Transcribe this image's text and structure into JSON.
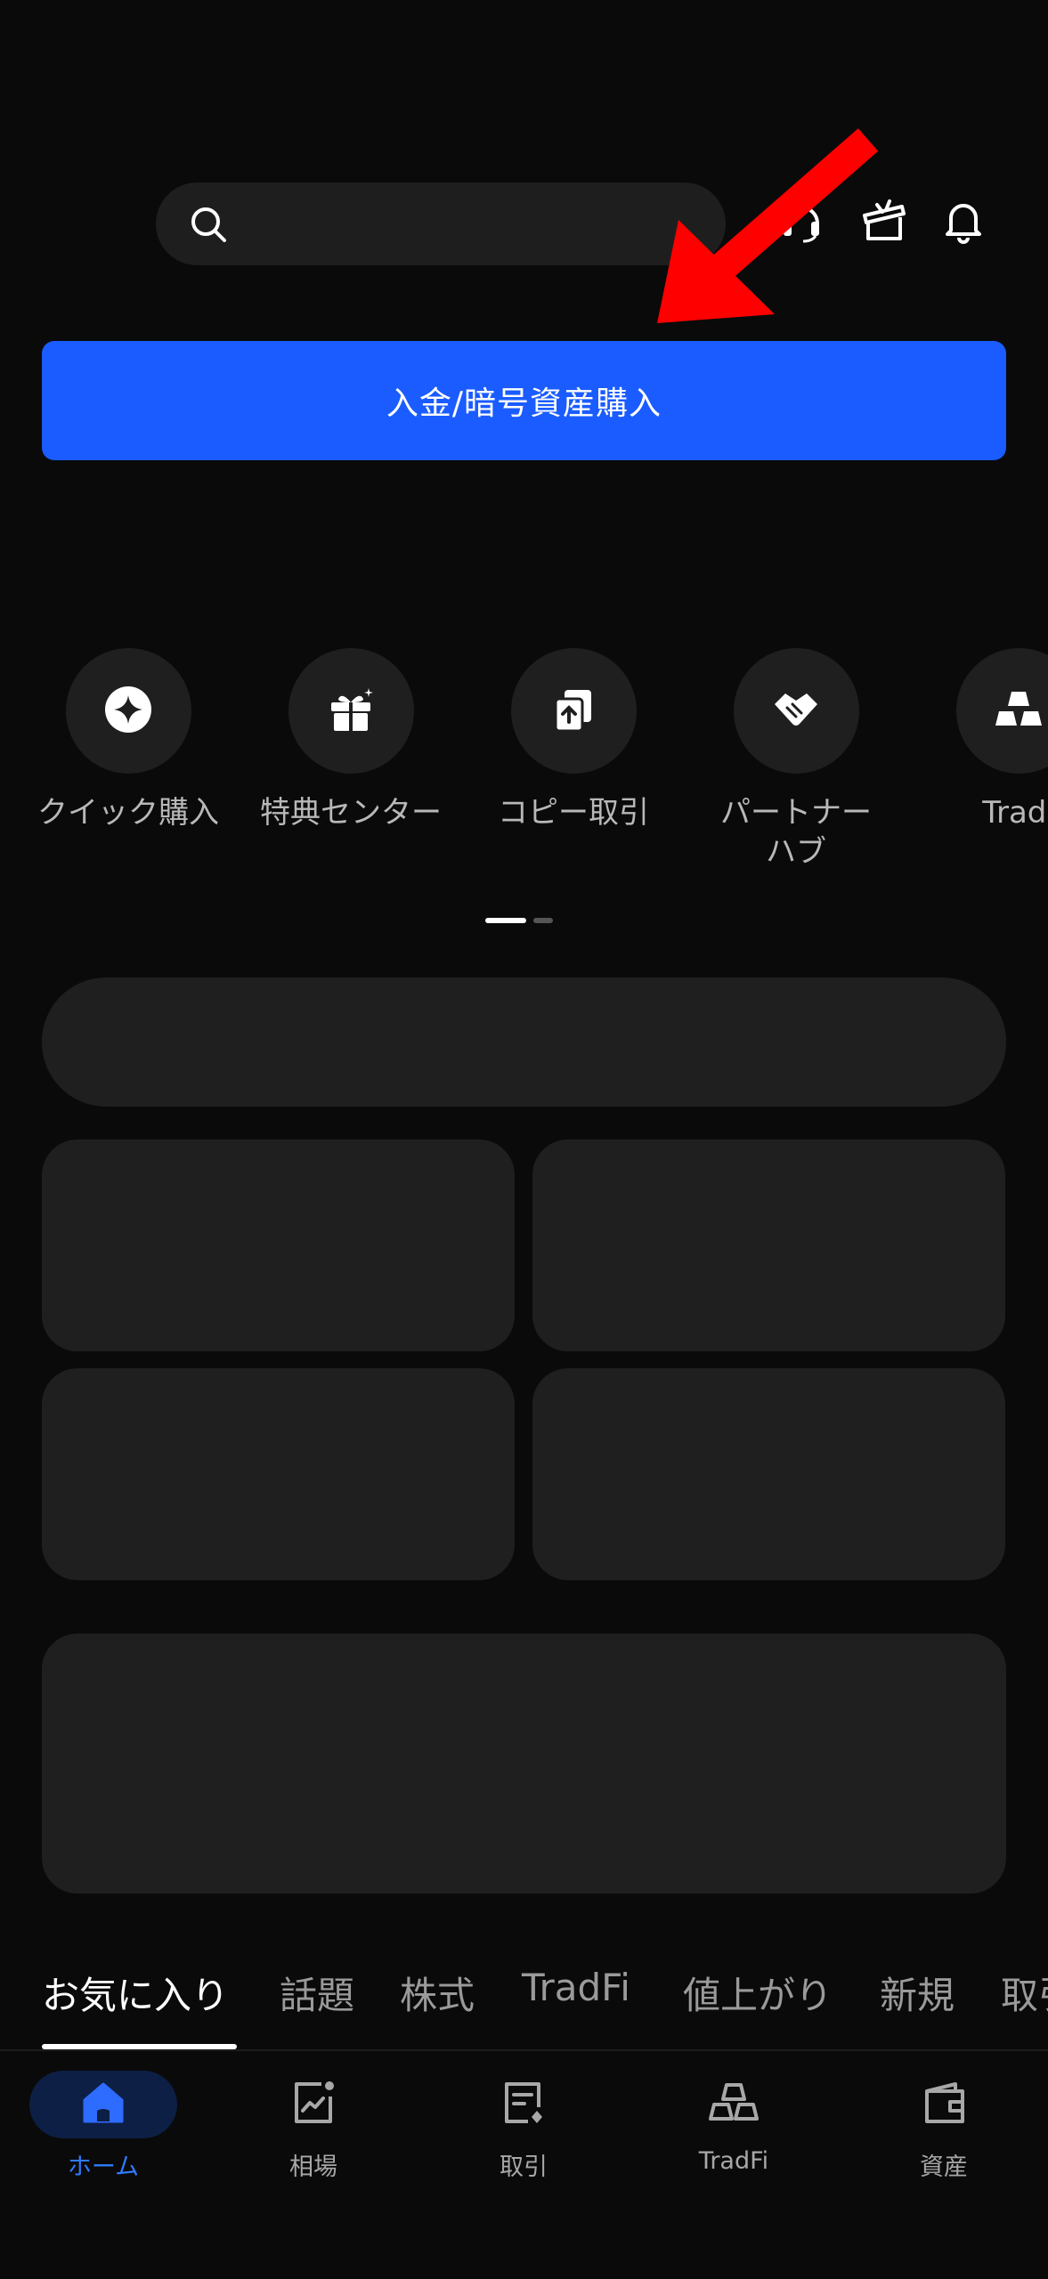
{
  "search": {
    "placeholder": ""
  },
  "header_icons": [
    "headset-icon",
    "gift-box-icon",
    "bell-icon"
  ],
  "deposit_button": {
    "label": "入金/暗号資産購入"
  },
  "quick_actions": [
    {
      "label": "クイック購入",
      "icon": "sparkle-icon"
    },
    {
      "label": "特典センター",
      "icon": "gift-icon"
    },
    {
      "label": "コピー取引",
      "icon": "copy-trade-icon"
    },
    {
      "label": "パートナー\nハブ",
      "icon": "handshake-icon"
    },
    {
      "label": "Tradl",
      "icon": "gold-bars-icon"
    }
  ],
  "tabs": [
    {
      "label": "お気に入り",
      "active": true
    },
    {
      "label": "話題"
    },
    {
      "label": "株式"
    },
    {
      "label": "TradFi"
    },
    {
      "label": "値上がり"
    },
    {
      "label": "新規"
    },
    {
      "label": "取引"
    }
  ],
  "bottom_nav": [
    {
      "label": "ホーム",
      "icon": "home-icon",
      "active": true
    },
    {
      "label": "相場",
      "icon": "market-chart-icon"
    },
    {
      "label": "取引",
      "icon": "trade-document-icon"
    },
    {
      "label": "TradFi",
      "icon": "gold-bars-icon"
    },
    {
      "label": "資産",
      "icon": "wallet-icon"
    }
  ],
  "colors": {
    "background": "#0a0a0a",
    "accent": "#1a5cff",
    "active_nav": "#2e7bff",
    "card": "#1f1f1f",
    "annotation_arrow": "#ff0000"
  }
}
